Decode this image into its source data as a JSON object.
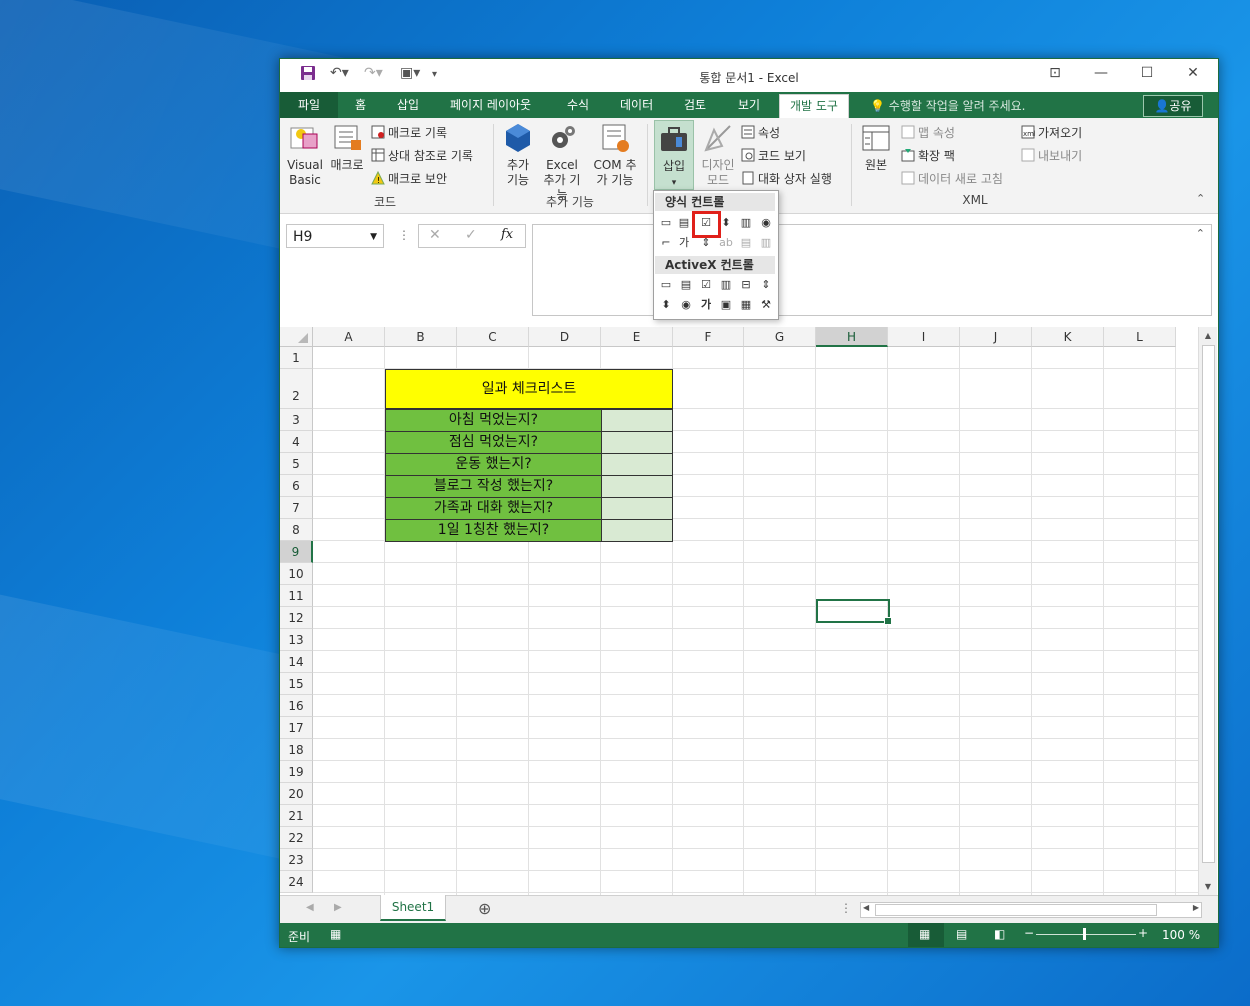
{
  "window": {
    "title": "통합 문서1 - Excel"
  },
  "ribbon_tabs": [
    "파일",
    "홈",
    "삽입",
    "페이지 레이아웃",
    "수식",
    "데이터",
    "검토",
    "보기",
    "개발 도구"
  ],
  "tell_me": "수행할 작업을 알려 주세요.",
  "share_label": "공유",
  "ribbon": {
    "code": {
      "label": "코드",
      "visual_basic": "Visual Basic",
      "macro": "매크로",
      "record_macro": "매크로 기록",
      "relative_ref": "상대 참조로 기록",
      "macro_security": "매크로 보안"
    },
    "addins": {
      "label": "추가 기능",
      "addins_btn": "추가 기능",
      "excel_addins": "Excel 추가 기능",
      "com_addins": "COM 추가 기능"
    },
    "controls": {
      "insert": "삽입",
      "design_mode": "디자인 모드",
      "properties": "속성",
      "view_code": "코드 보기",
      "run_dialog": "대화 상자 실행"
    },
    "xml": {
      "label": "XML",
      "source": "원본",
      "map_props": "맵 속성",
      "expansion_packs": "확장 팩",
      "refresh_data": "데이터 새로 고침",
      "import": "가져오기",
      "export": "내보내기"
    }
  },
  "insert_dropdown": {
    "form_controls": "양식 컨트롤",
    "activex_controls": "ActiveX 컨트롤",
    "highlighted": "checkbox-form-control"
  },
  "formula_bar": {
    "name_box": "H9",
    "fx": "fx",
    "value": ""
  },
  "columns": [
    "A",
    "B",
    "C",
    "D",
    "E",
    "F",
    "G",
    "H",
    "I",
    "J",
    "K",
    "L"
  ],
  "rows": [
    "1",
    "2",
    "3",
    "4",
    "5",
    "6",
    "7",
    "8",
    "9",
    "10",
    "11",
    "12",
    "13",
    "14",
    "15",
    "16",
    "17",
    "18",
    "19",
    "20",
    "21",
    "22",
    "23",
    "24"
  ],
  "selected_cell": "H9",
  "checklist": {
    "title": "일과 체크리스트",
    "items": [
      "아침 먹었는지?",
      "점심 먹었는지?",
      "운동 했는지?",
      "블로그 작성 했는지?",
      "가족과 대화 했는지?",
      "1일 1칭찬 했는지?"
    ],
    "title_color": "#ffff00",
    "item_color": "#70c040",
    "check_color": "#d9ead3"
  },
  "sheet_tabs": [
    "Sheet1"
  ],
  "status": {
    "ready": "준비",
    "zoom": "100 %"
  }
}
